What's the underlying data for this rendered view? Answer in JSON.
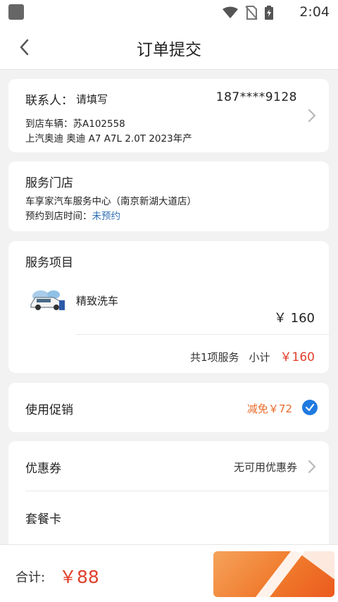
{
  "status": {
    "time": "2:04"
  },
  "header": {
    "title": "订单提交"
  },
  "contact": {
    "label": "联系人：",
    "name_placeholder": "请填写",
    "phone": "187****9128",
    "vehicle_line": "到店车辆：苏A102558",
    "vehicle_model": "上汽奥迪 奥迪 A7 A7L 2.0T 2023年产"
  },
  "store": {
    "title": "服务门店",
    "name": "车享家汽车服务中心（南京新湖大道店）",
    "appointment_label": "预约到店时间：",
    "appointment_value": "未预约"
  },
  "service": {
    "title": "服务项目",
    "item_name": "精致洗车",
    "item_price": "￥ 160",
    "count_text": "共1项服务",
    "subtotal_label": "小计",
    "subtotal_value": "￥160"
  },
  "promo": {
    "label": "使用促销",
    "discount": "减免￥72",
    "checked": true
  },
  "coupon": {
    "label": "优惠券",
    "value": "无可用优惠券"
  },
  "package": {
    "label": "套餐卡"
  },
  "footer": {
    "total_label": "合计:",
    "total_value": "￥88"
  },
  "colors": {
    "price_red": "#e0402a",
    "discount_orange": "#e86a2a",
    "link_blue": "#2f6fb5",
    "check_blue": "#1f7ae0",
    "submit_orange": "#f07a2c"
  },
  "icons": [
    "app-icon",
    "wifi-icon",
    "no-sim-icon",
    "battery-icon",
    "back-arrow-icon",
    "chevron-right-icon",
    "checkmark-icon",
    "car-thumbnail"
  ]
}
